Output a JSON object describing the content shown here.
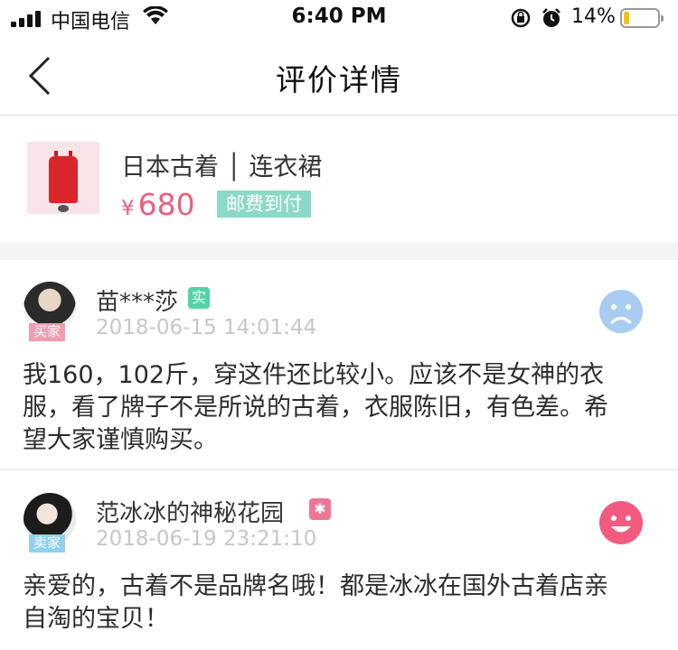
{
  "status_bar": {
    "carrier": "中国电信",
    "time": "6:40 PM",
    "battery_pct": "14%",
    "battery_level": 0.14,
    "icons": [
      "signal-icon",
      "wifi-icon",
      "rotation-lock-icon",
      "alarm-icon",
      "battery-icon"
    ]
  },
  "nav": {
    "title": "评价详情",
    "back_icon": "chevron-left-icon"
  },
  "product": {
    "title": "日本古着 │ 连衣裙",
    "currency": "¥",
    "price": "680",
    "shipping_badge": "邮费到付"
  },
  "reviews": [
    {
      "user": "苗***莎",
      "verify_badge": "实",
      "role": "买家",
      "date": "2018-06-15 14:01:44",
      "sentiment": "sad-face-icon",
      "sentiment_color": "#a9cdf0",
      "lines": [
        "我160，102斤，穿这件还比较小。应该不是女神的衣",
        "服，看了牌子不是所说的古着，衣服陈旧，有色差。希",
        "望大家谨慎购买。"
      ]
    },
    {
      "user": "范冰冰的神秘花园",
      "verify_badge": "✱",
      "role": "卖家",
      "date": "2018-06-19 23:21:10",
      "sentiment": "happy-face-icon",
      "sentiment_color": "#f25b7f",
      "lines": [
        "亲爱的，古着不是品牌名哦！都是冰冰在国外古着店亲",
        "自淘的宝贝！"
      ]
    }
  ],
  "colors": {
    "price": "#e9617f",
    "shipping_badge": "#8bd9c7",
    "buyer_badge": "#f39bb1",
    "seller_badge": "#8fd1ee"
  }
}
